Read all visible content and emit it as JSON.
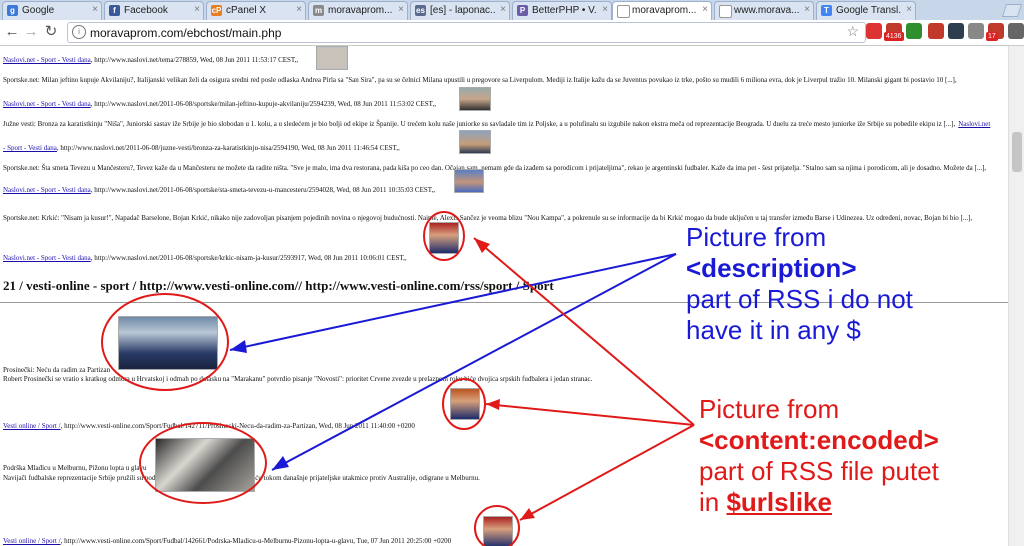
{
  "browser": {
    "tabs": [
      {
        "label": "Google",
        "icon": "google-icon",
        "color": "#3c78d8",
        "glyph": "g"
      },
      {
        "label": "Facebook",
        "icon": "facebook-icon",
        "color": "#3b5998",
        "glyph": "f"
      },
      {
        "label": "cPanel X",
        "icon": "cpanel-icon",
        "color": "#e67e22",
        "glyph": "cP"
      },
      {
        "label": "moravaprom....",
        "icon": "page-icon",
        "color": "#8a8a8a",
        "glyph": "m"
      },
      {
        "label": "[es] - laponac...",
        "icon": "es-icon",
        "color": "#5b6a8c",
        "glyph": "es"
      },
      {
        "label": "BetterPHP • V...",
        "icon": "php-icon",
        "color": "#6a5ea8",
        "glyph": "P"
      },
      {
        "label": "moravaprom....",
        "icon": "document-icon",
        "color": "#ffffff",
        "glyph": ""
      },
      {
        "label": "www.morava...",
        "icon": "document-icon",
        "color": "#ffffff",
        "glyph": ""
      },
      {
        "label": "Google Transl...",
        "icon": "translate-icon",
        "color": "#4285f4",
        "glyph": "T"
      }
    ],
    "url": "moravaprom.com/ebchost/main.php",
    "extensions": [
      {
        "name": "exit-extension-icon",
        "color": "#d33"
      },
      {
        "name": "rss-counter-extension-icon",
        "color": "#c0392b",
        "badge": "4136"
      },
      {
        "name": "search-extension-icon",
        "color": "#2f8f2f"
      },
      {
        "name": "adblock-extension-icon",
        "color": "#c0392b"
      },
      {
        "name": "download-extension-icon",
        "color": "#2c3e50"
      },
      {
        "name": "extension-icon",
        "color": "#888888"
      },
      {
        "name": "gmail-extension-icon",
        "color": "#c0392b",
        "badge": "17"
      },
      {
        "name": "wrench-icon",
        "color": "#666666"
      }
    ]
  },
  "page": {
    "lines": [
      {
        "source": "Naslovi.net - Sport - Vesti dana",
        "meta": ", http://www.naslovi.net/tema/278859, Wed, 08 Jun 2011 11:53:17 CEST,,"
      },
      {
        "text": "Sportske.net: Milan jeftino kupuje Akvilaniju?, Italijanski velikan želi da osigura sredni red posle odlaska Andrea Pirla sa \"San Sira\", pa su se čelnici Milana upustili u pregovore sa Liverpulom. Mediji iz Italije kažu da se Juventus povukao iz trke, pošto su mudili 6 miliona evra, dok je Liverpul tražio 10. Milanski gigant bi postavio 10 [...],"
      },
      {
        "source": "Naslovi.net - Sport - Vesti dana",
        "meta": ", http://www.naslovi.net/2011-06-08/sportske/milan-jeftino-kupuje-akvilaniju/2594239, Wed, 08 Jun 2011 11:53:02 CEST,,"
      },
      {
        "text": "Južne vesti: Bronza za karatistkinju \"Niša\", Juniorski sastav iže Srbije je bio slobodan u 1. kolu, a u sledećem je bio bolji od ekipe iz Španije. U trećem kolu naše juniorke su savladale tim iz Poljske, a u polufinalu su izgubile nakon ekstra meča od reprezentacije Beograda. U duelu za treće mesto juniorke iže Srbije su pobedile ekipu iz [...],",
        "trail": "Naslovi.net"
      },
      {
        "source": "- Sport - Vesti dana",
        "meta": ", http://www.naslovi.net/2011-06-08/juzne-vesti/bronza-za-karatistkinju-nisa/2594190, Wed, 08 Jun 2011 11:46:54 CEST,,"
      },
      {
        "text": "Sportske.net: Šta smeta Tevezu u Mančesteru?, Tevez kaže da u Mančesteru ne možete da radite ništa. \"Sve je malo, ima dva restorana, pada kiša po ceo dan. Očajan sam, nemam gde da izađem sa porodicom i prijateljima\", rekao je argentinski fudbaler. Kaže da ima pet - šest prijatelja. \"Stalno sam sa njima i porodicom, ali je dosadno. Možete da [...],"
      },
      {
        "source": "Naslovi.net - Sport - Vesti dana",
        "meta": ", http://www.naslovi.net/2011-06-08/sportske/sta-smeta-tevezu-u-mancesteru/2594028, Wed, 08 Jun 2011 10:35:03 CEST,,"
      },
      {
        "text": "Sportske.net: Krkić: \"Nisam ja kusur!\", Napadač Barselone, Bojan Krkić, nikako nije zadovoljan pisanjem pojedinih novina o njegovoj budućnosti. Naime, Alexis Sančez je veoma blizu \"Nou Kampa\", a pokrenule su se informacije da bi Krkić mogao da bude uključen u taj transfer između Barse i Udinezea. Uz određeni, novac, Bojan bi bio [...],"
      },
      {
        "source": "Naslovi.net - Sport - Vesti dana",
        "meta": ", http://www.naslovi.net/2011-06-08/sportske/krkic-nisam-ja-kusur/2593917, Wed, 08 Jun 2011 10:06:01 CEST,,"
      }
    ],
    "heading": "21 / vesti-online - sport / http://www.vesti-online.com// http://www.vesti-online.com/rss/sport / Sport",
    "lower_lines": [
      {
        "text": "Prosinečki: Neću da radim za Partizan"
      },
      {
        "text": "Robert Prosinečki se vratio s kratkog odmora u Hrvatskoj i odmah po dolasku na \"Marakanu\" potvrdio pisanje \"Novosti\": prioritet Crvene zvezde u prelaznom roku biće dvojica srpskih fudbalera i jedan stranac."
      },
      {
        "source": "Vesti online / Sport /",
        "meta": ", http://www.vesti-online.com/Sport/Fudbal/142711/Prosinecki-Necu-da-radim-za-Partizan, Wed, 08 Jun 2011 11:40:00 +0200"
      },
      {
        "text": "Podrška Mlađicu u Melburnu, Pižonu lopta u glavu"
      },
      {
        "text": "Navijači fudbalske reprezentacije Srbije pružili su podršku ratnom generalnu Ratku Mlađiću tokom današnje prijateljske utakmice protiv Australije, odigrane u Melburnu."
      },
      {
        "source": "Vesti online / Sport /",
        "meta": ", http://www.vesti-online.com/Sport/Fudbal/142661/Podrska-Mladicu-u-Melburnu-Pizonu-lopta-u-glavu, Tue, 07 Jun 2011 20:25:00 +0200"
      }
    ]
  },
  "annotations": {
    "blue": {
      "line1": "Picture from",
      "line2": "<description>",
      "line3": "part of RSS i do not",
      "line4": "have it in any $",
      "color": "#1a1ad6"
    },
    "red": {
      "line1": "Picture from",
      "line2": "<content:encoded>",
      "line3": "part of RSS file putet",
      "line4_prefix": "in ",
      "line4_var": "$urlslike",
      "color": "#e01919"
    }
  }
}
